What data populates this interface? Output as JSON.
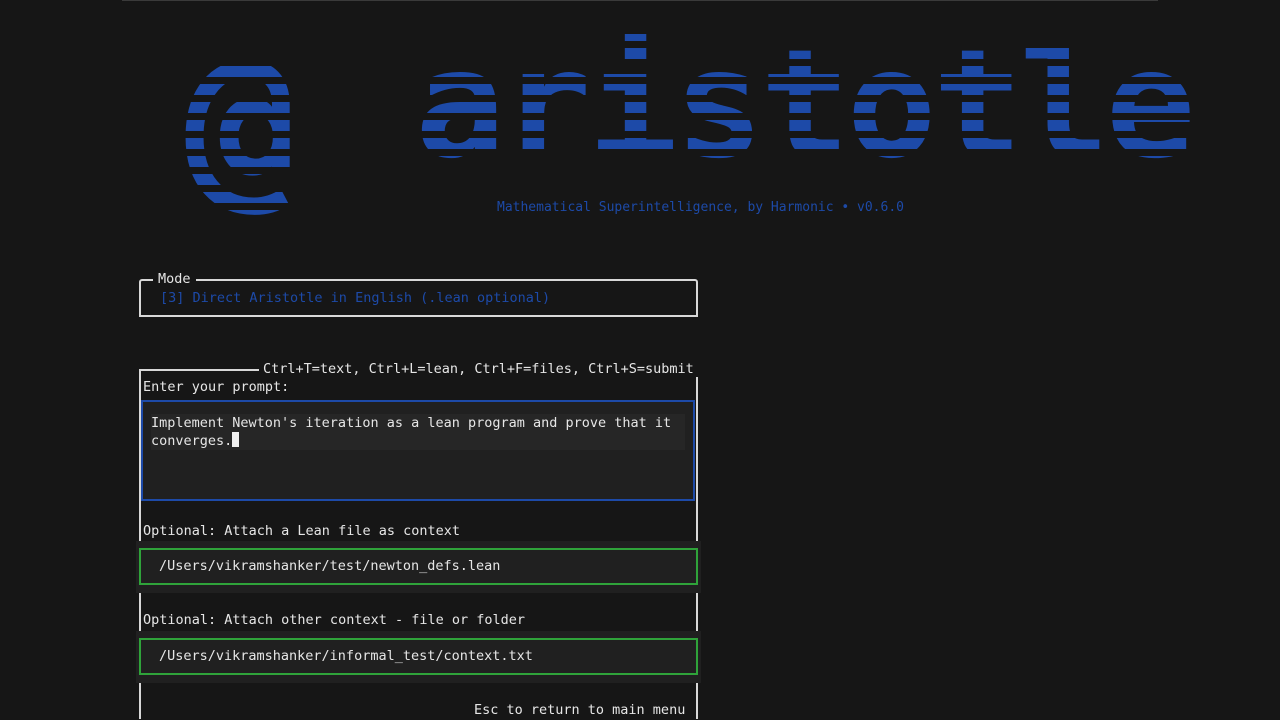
{
  "logo": {
    "text": "@ aristotle"
  },
  "tagline": "Mathematical Superintelligence, by Harmonic • v0.6.0",
  "mode": {
    "title": "Mode",
    "value": "[3] Direct Aristotle in English (.lean optional)"
  },
  "prompt": {
    "shortcuts": "Ctrl+T=text, Ctrl+L=lean, Ctrl+F=files, Ctrl+S=submit",
    "label": "Enter your prompt:",
    "value": "Implement Newton's iteration as a lean program and prove that it\nconverges."
  },
  "lean_file": {
    "label": "Optional: Attach a Lean file as context",
    "value": "/Users/vikramshanker/test/newton_defs.lean"
  },
  "other_context": {
    "label": "Optional: Attach other context - file or folder",
    "value": "/Users/vikramshanker/informal_test/context.txt"
  },
  "footer": {
    "esc_hint": "Esc to return to main menu"
  },
  "colors": {
    "accent": "#1d4aa8",
    "field_border": "#2fa33a"
  }
}
